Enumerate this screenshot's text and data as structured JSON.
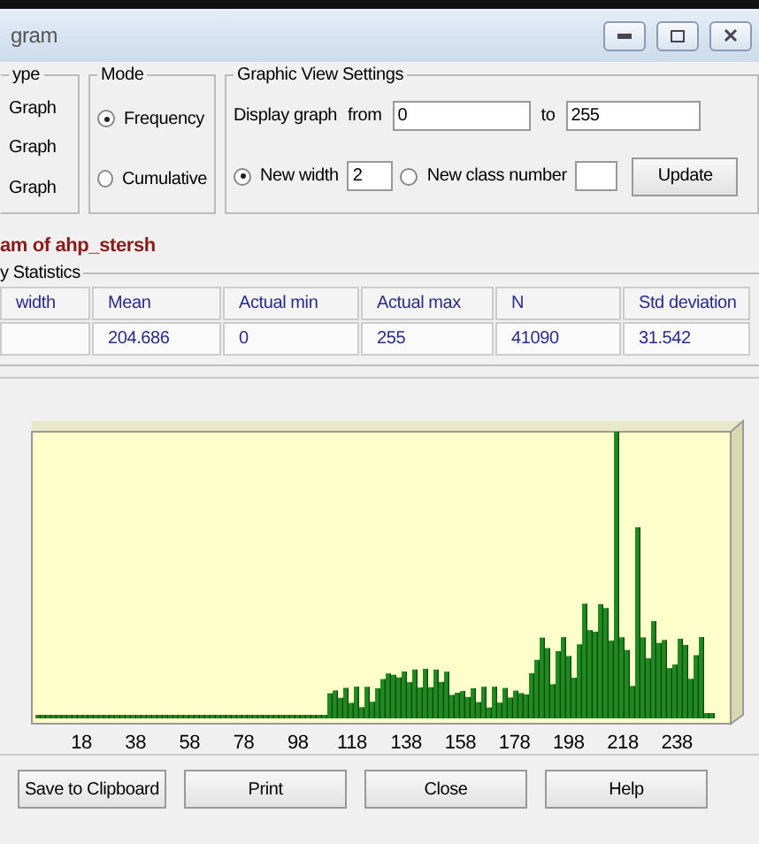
{
  "window": {
    "title": "gram"
  },
  "type_group": {
    "legend": "ype",
    "options": [
      "Graph",
      "Graph",
      "Graph"
    ]
  },
  "mode_group": {
    "legend": "Mode",
    "options": [
      {
        "label": "Frequency",
        "selected": true
      },
      {
        "label": "Cumulative",
        "selected": false
      }
    ]
  },
  "view_settings": {
    "legend": "Graphic View Settings",
    "display_label": "Display graph",
    "from_label": "from",
    "from_value": "0",
    "to_label": "to",
    "to_value": "255",
    "options": [
      {
        "label": "New width",
        "value": "2",
        "selected": true
      },
      {
        "label": "New class number",
        "selected": false
      }
    ],
    "update_button": "Update"
  },
  "heading": "am of ahp_stersh",
  "statistics": {
    "legend": "y Statistics",
    "columns": [
      "width",
      "Mean",
      "Actual min",
      "Actual max",
      "N",
      "Std deviation"
    ],
    "row": [
      "204.686",
      "0",
      "255",
      "41090",
      "31.542"
    ]
  },
  "histogram": {
    "x_labels": [
      "18",
      "38",
      "58",
      "78",
      "98",
      "118",
      "138",
      "158",
      "178",
      "198",
      "218",
      "238"
    ]
  },
  "buttons": [
    "Save to Clipboard",
    "Print",
    "Close",
    "Help"
  ]
}
